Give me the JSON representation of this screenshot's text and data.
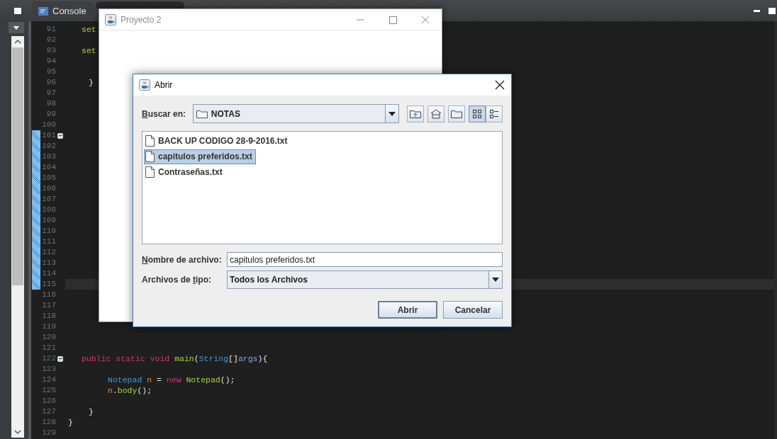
{
  "ide": {
    "tabs": [
      {
        "kind": "console",
        "label": "Console",
        "selected": false
      },
      {
        "kind": "java",
        "selected": true
      }
    ],
    "lines": [
      {
        "number": "91",
        "fold": false,
        "changed": false,
        "current": false,
        "kind": "member",
        "tokens": [
          {
            "kind": "method",
            "text": "set"
          }
        ]
      },
      {
        "number": "92",
        "fold": false,
        "changed": false,
        "current": false
      },
      {
        "number": "93",
        "fold": false,
        "changed": false,
        "current": false,
        "kind": "member",
        "tokens": [
          {
            "kind": "method",
            "text": "set"
          }
        ]
      },
      {
        "number": "94",
        "fold": false,
        "changed": false,
        "current": false
      },
      {
        "number": "95",
        "fold": false,
        "changed": false,
        "current": false
      },
      {
        "number": "96",
        "fold": false,
        "changed": false,
        "current": false,
        "kind": "close",
        "tokens": [
          {
            "kind": "plain",
            "text": "}"
          }
        ]
      },
      {
        "number": "97",
        "fold": false,
        "changed": false,
        "current": false
      },
      {
        "number": "98",
        "fold": false,
        "changed": false,
        "current": false
      },
      {
        "number": "99",
        "fold": false,
        "changed": false,
        "current": false
      },
      {
        "number": "100",
        "fold": false,
        "changed": false,
        "current": false
      },
      {
        "number": "101",
        "fold": true,
        "changed": true,
        "current": false
      },
      {
        "number": "102",
        "fold": false,
        "changed": true,
        "current": false
      },
      {
        "number": "103",
        "fold": false,
        "changed": true,
        "current": false
      },
      {
        "number": "104",
        "fold": false,
        "changed": true,
        "current": false
      },
      {
        "number": "105",
        "fold": false,
        "changed": true,
        "current": false
      },
      {
        "number": "106",
        "fold": false,
        "changed": true,
        "current": false
      },
      {
        "number": "107",
        "fold": false,
        "changed": true,
        "current": false
      },
      {
        "number": "108",
        "fold": false,
        "changed": true,
        "current": false
      },
      {
        "number": "109",
        "fold": false,
        "changed": true,
        "current": false
      },
      {
        "number": "110",
        "fold": false,
        "changed": true,
        "current": false
      },
      {
        "number": "111",
        "fold": false,
        "changed": true,
        "current": false
      },
      {
        "number": "112",
        "fold": false,
        "changed": true,
        "current": false
      },
      {
        "number": "113",
        "fold": false,
        "changed": true,
        "current": false
      },
      {
        "number": "114",
        "fold": false,
        "changed": true,
        "current": false
      },
      {
        "number": "115",
        "fold": false,
        "changed": true,
        "current": true
      },
      {
        "number": "116",
        "fold": false,
        "changed": false,
        "current": false
      },
      {
        "number": "117",
        "fold": false,
        "changed": false,
        "current": false
      },
      {
        "number": "118",
        "fold": false,
        "changed": false,
        "current": false
      },
      {
        "number": "119",
        "fold": false,
        "changed": false,
        "current": false
      },
      {
        "number": "120",
        "fold": false,
        "changed": false,
        "current": false
      },
      {
        "number": "121",
        "fold": false,
        "changed": false,
        "current": false
      },
      {
        "number": "122",
        "fold": true,
        "changed": false,
        "current": false,
        "kind": "member",
        "tokens": [
          {
            "kind": "keyword",
            "text": "public static void "
          },
          {
            "kind": "method",
            "text": "main"
          },
          {
            "kind": "plain",
            "text": "("
          },
          {
            "kind": "type",
            "text": "String"
          },
          {
            "kind": "plain",
            "text": "[]"
          },
          {
            "kind": "param",
            "text": "args"
          },
          {
            "kind": "plain",
            "text": "){"
          }
        ]
      },
      {
        "number": "123",
        "fold": false,
        "changed": false,
        "current": false
      },
      {
        "number": "124",
        "fold": false,
        "changed": false,
        "current": false,
        "kind": "body",
        "tokens": [
          {
            "kind": "type",
            "text": "Notepad "
          },
          {
            "kind": "var",
            "text": "n"
          },
          {
            "kind": "plain",
            "text": " = "
          },
          {
            "kind": "keyword",
            "text": "new "
          },
          {
            "kind": "method",
            "text": "Notepad"
          },
          {
            "kind": "plain",
            "text": "();"
          }
        ]
      },
      {
        "number": "125",
        "fold": false,
        "changed": false,
        "current": false,
        "kind": "body",
        "tokens": [
          {
            "kind": "var",
            "text": "n"
          },
          {
            "kind": "plain",
            "text": "."
          },
          {
            "kind": "method",
            "text": "body"
          },
          {
            "kind": "plain",
            "text": "();"
          }
        ]
      },
      {
        "number": "126",
        "fold": false,
        "changed": false,
        "current": false
      },
      {
        "number": "127",
        "fold": false,
        "changed": false,
        "current": false,
        "kind": "close",
        "tokens": [
          {
            "kind": "plain",
            "text": "}"
          }
        ]
      },
      {
        "number": "128",
        "fold": false,
        "changed": false,
        "current": false,
        "kind": "none",
        "tokens": [
          {
            "kind": "plain",
            "text": "}"
          }
        ]
      },
      {
        "number": "129",
        "fold": false,
        "changed": false,
        "current": false
      }
    ]
  },
  "window": {
    "title": "Proyecto 2"
  },
  "dialog": {
    "title": "Abrir",
    "look_in": {
      "label": {
        "key": "B",
        "post": "uscar en:"
      },
      "value": "NOTAS"
    },
    "view_modes": [
      {
        "kind": "list",
        "selected": true
      },
      {
        "kind": "details",
        "selected": false
      }
    ],
    "files": [
      {
        "name": "BACK UP CODIGO 28-9-2016.txt",
        "selected": false
      },
      {
        "name": "capitulos preferidos.txt",
        "selected": true
      },
      {
        "name": "Contraseñas.txt",
        "selected": false
      }
    ],
    "file_name": {
      "label": {
        "key": "N",
        "post": "ombre de archivo:"
      },
      "value": "capitulos preferidos.txt"
    },
    "file_type": {
      "label": {
        "pre": "Archivos de ",
        "key": "t",
        "post": "ipo:"
      },
      "value": "Todos los Archivos"
    },
    "buttons": [
      {
        "label": "Abrir",
        "default": true
      },
      {
        "label": "Cancelar",
        "default": false
      }
    ]
  }
}
